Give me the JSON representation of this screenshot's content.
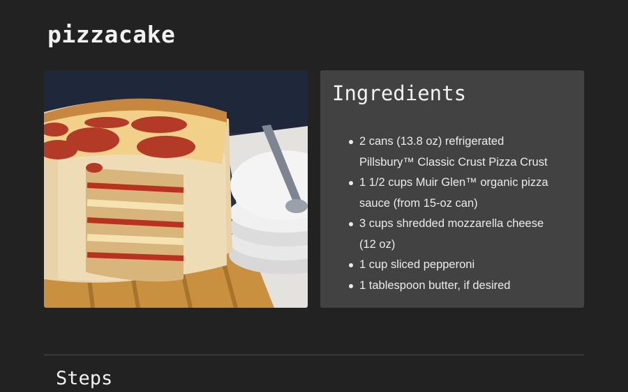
{
  "recipe": {
    "title": "pizzacake",
    "image_alt": "pizzacake"
  },
  "ingredients": {
    "heading": "Ingredients",
    "items": [
      "2 cans (13.8 oz) refrigerated Pillsbury™ Classic Crust Pizza Crust",
      "1 1/2 cups Muir Glen™ organic pizza sauce (from 15-oz can)",
      "3 cups shredded mozzarella cheese (12 oz)",
      "1 cup sliced pepperoni",
      "1 tablespoon butter, if desired"
    ]
  },
  "steps": {
    "heading": "Steps"
  },
  "colors": {
    "background": "#222222",
    "panel": "#424242",
    "text": "#eeeeee"
  }
}
